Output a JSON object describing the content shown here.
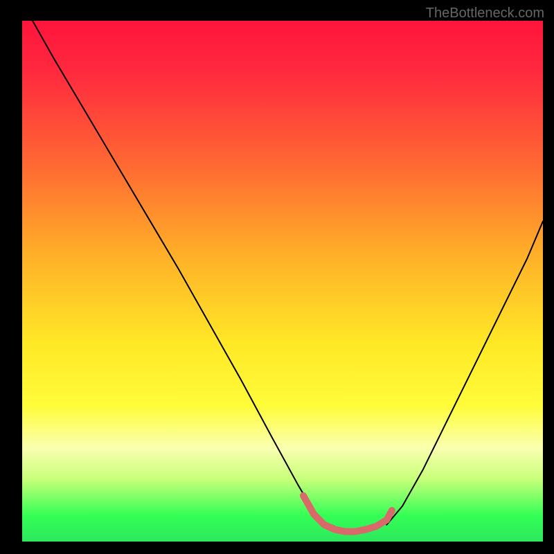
{
  "watermark": "TheBottleneck.com",
  "chart_data": {
    "type": "line",
    "title": "",
    "xlabel": "",
    "ylabel": "",
    "xlim": [
      0,
      100
    ],
    "ylim": [
      0,
      100
    ],
    "gradient_stops": [
      {
        "offset": 0.0,
        "color": "#ff143c"
      },
      {
        "offset": 0.1,
        "color": "#ff2a3f"
      },
      {
        "offset": 0.28,
        "color": "#ff6a32"
      },
      {
        "offset": 0.45,
        "color": "#ffb028"
      },
      {
        "offset": 0.62,
        "color": "#ffe826"
      },
      {
        "offset": 0.74,
        "color": "#fffc3a"
      },
      {
        "offset": 0.82,
        "color": "#faffb0"
      },
      {
        "offset": 0.88,
        "color": "#c8ff7a"
      },
      {
        "offset": 0.95,
        "color": "#34ff55"
      },
      {
        "offset": 1.0,
        "color": "#2ce85d"
      }
    ],
    "series": [
      {
        "name": "left-curve",
        "color": "#000000",
        "width": 2,
        "x": [
          2,
          6,
          12,
          18,
          24,
          30,
          36,
          42,
          48,
          53,
          56,
          58,
          60
        ],
        "y": [
          100,
          93,
          83,
          73,
          63,
          53,
          42.5,
          32,
          21,
          12,
          7,
          5,
          4.2
        ]
      },
      {
        "name": "right-curve",
        "color": "#000000",
        "width": 2,
        "x": [
          70,
          73,
          77,
          81,
          85,
          89,
          93,
          97,
          100
        ],
        "y": [
          4.5,
          8,
          15,
          23,
          31,
          39,
          47,
          55,
          62
        ]
      },
      {
        "name": "valley-marker",
        "color": "#d86a6a",
        "width": 10,
        "x": [
          54,
          56,
          58,
          60,
          62,
          64,
          66,
          68,
          70,
          71
        ],
        "y": [
          10,
          6.5,
          4.5,
          3.6,
          3.2,
          3.2,
          3.6,
          4.2,
          5.4,
          7.2
        ]
      }
    ]
  }
}
